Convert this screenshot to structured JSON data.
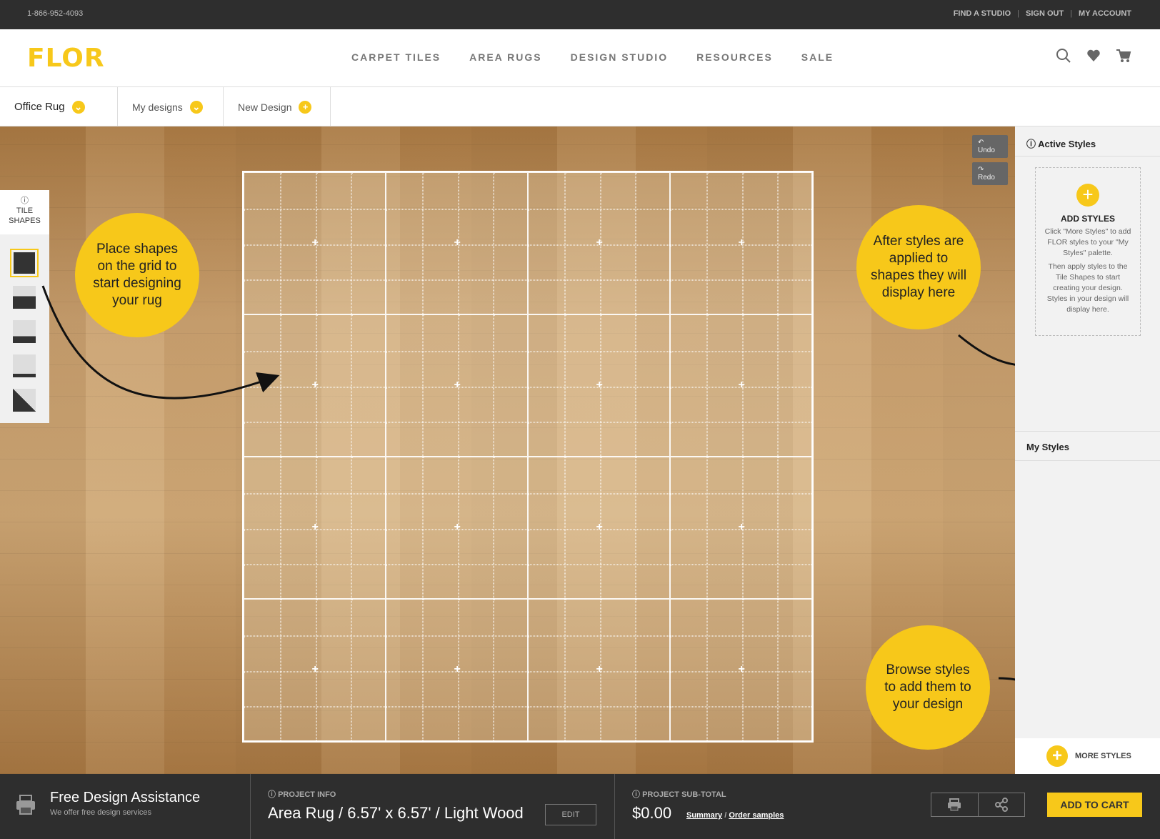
{
  "topbar": {
    "phone": "1-866-952-4093",
    "find_studio": "FIND A STUDIO",
    "sign_out": "SIGN OUT",
    "my_account": "MY ACCOUNT"
  },
  "header": {
    "logo": "FLOR",
    "nav": [
      "CARPET TILES",
      "AREA RUGS",
      "DESIGN STUDIO",
      "RESOURCES",
      "SALE"
    ],
    "icons": [
      "search-icon",
      "heart-icon",
      "cart-icon"
    ]
  },
  "tabs": [
    {
      "label": "Office Rug",
      "badge": "chevron-down-icon"
    },
    {
      "label": "My designs",
      "badge": "chevron-down-icon"
    },
    {
      "label": "New Design",
      "badge": "plus-icon"
    }
  ],
  "canvas": {
    "undo": "Undo",
    "redo": "Redo",
    "tool_panel_title": "TILE\nSHAPES",
    "callouts": {
      "left": "Place shapes on the grid to start designing your rug",
      "right": "After styles are applied to shapes they will display here",
      "bottom": "Browse styles to add them to your design"
    }
  },
  "sidebar": {
    "active_styles": "Active Styles",
    "add_styles_title": "ADD STYLES",
    "add_styles_p1": "Click \"More Styles\" to add FLOR styles to your \"My Styles\" palette.",
    "add_styles_p2": "Then apply styles to the Tile Shapes to start creating your design. Styles in your design will display here.",
    "my_styles": "My Styles",
    "more_styles": "MORE STYLES"
  },
  "footer": {
    "assist_title": "Free Design Assistance",
    "assist_sub": "We offer free design services",
    "project_info_label": "PROJECT INFO",
    "project_info": "Area Rug / 6.57' x 6.57' / Light Wood",
    "edit": "EDIT",
    "subtotal_label": "PROJECT SUB-TOTAL",
    "subtotal": "$0.00",
    "summary": "Summary",
    "link_sep": "/",
    "order_samples": "Order samples",
    "add_to_cart": "ADD TO CART"
  },
  "colors": {
    "accent": "#f7c81a",
    "dark": "#2e2e2e"
  }
}
